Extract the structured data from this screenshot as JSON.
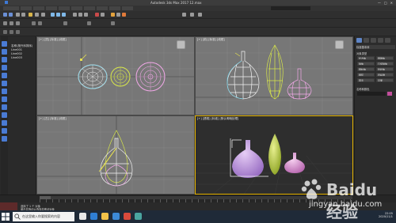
{
  "window": {
    "title": "Autodesk 3ds Max 2017    12.max",
    "controls": [
      "—",
      "□",
      "✕"
    ]
  },
  "viewports": {
    "top": {
      "label": "[+] [顶] [标准] [线框]"
    },
    "front": {
      "label": "[+] [前] [标准] [线框]"
    },
    "left": {
      "label": "[+] [左] [标准] [线框]"
    },
    "perspective": {
      "label": "[+] [透视] [标准] [默认明暗处理]"
    }
  },
  "scene_explorer": {
    "items": [
      "名称(按升序排序)",
      "Line001",
      "Line002",
      "Line003"
    ]
  },
  "command_panel": {
    "header": "标准基本体",
    "rollout1": "对象类型",
    "buttons": [
      "长方体",
      "圆锥体",
      "球体",
      "几何球体",
      "圆柱体",
      "管状体",
      "圆环",
      "四棱锥",
      "茶壶",
      "平面"
    ],
    "rollout2": "名称和颜色"
  },
  "timeline": {
    "range": "0 / 100"
  },
  "status": {
    "line1": "选择了 1 个 对象",
    "line2": "单击并拖动以选择并移动对象"
  },
  "taskbar": {
    "search_placeholder": "在这里输入你要搜索的内容",
    "time": "22:05",
    "date": "2020/11/1"
  },
  "watermark": {
    "text": "Baidu 经验",
    "url": "jingyan.baidu.com"
  },
  "colors": {
    "viewport_bg": "#777777",
    "perspective_bg": "#2e2e2e",
    "active_border": "#e6b400",
    "vase_white": "#f4f4f4",
    "vase_yellow": "#d9e84a",
    "vase_pink": "#f2a8e8",
    "vase_purple": "#c9a6e6"
  }
}
